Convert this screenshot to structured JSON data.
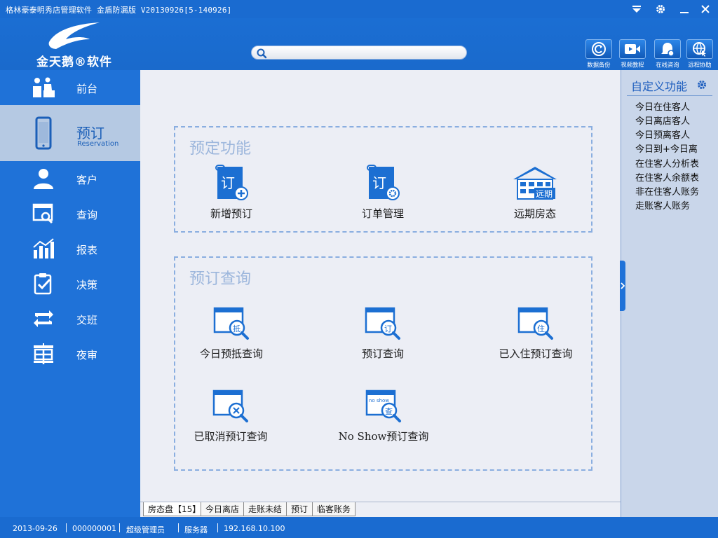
{
  "window": {
    "title": "格林豪泰明秀店管理软件 金盾防漏版 V20130926[5-140926]"
  },
  "brand": {
    "name": "金天鹅",
    "suffix": "软件"
  },
  "search": {
    "placeholder": "",
    "value": ""
  },
  "toolbar": [
    {
      "label": "数据备份",
      "icon": "backup-icon"
    },
    {
      "label": "视频教程",
      "icon": "video-icon"
    },
    {
      "label": "在线咨询",
      "icon": "chat-icon"
    },
    {
      "label": "远程协助",
      "icon": "remote-icon"
    }
  ],
  "sidebar": {
    "items": [
      {
        "label": "前台",
        "icon": "front-desk-icon"
      },
      {
        "label": "预订",
        "sub": "Reservation",
        "icon": "phone-icon",
        "active": true
      },
      {
        "label": "客户",
        "icon": "customer-icon"
      },
      {
        "label": "查询",
        "icon": "query-icon"
      },
      {
        "label": "报表",
        "icon": "report-icon"
      },
      {
        "label": "决策",
        "icon": "decision-icon"
      },
      {
        "label": "交班",
        "icon": "shift-icon"
      },
      {
        "label": "夜审",
        "icon": "night-audit-icon"
      }
    ]
  },
  "groups": [
    {
      "title": "预定功能",
      "items": [
        {
          "label": "新增预订",
          "icon_text": "订"
        },
        {
          "label": "订单管理",
          "icon_text": "订"
        },
        {
          "label": "远期房态",
          "icon_text": "远期"
        }
      ]
    },
    {
      "title": "预订查询",
      "items": [
        {
          "label": "今日预抵查询",
          "icon_text": "抵"
        },
        {
          "label": "预订查询",
          "icon_text": "订"
        },
        {
          "label": "已入住预订查询",
          "icon_text": "住"
        },
        {
          "label": "已取消预订查询",
          "icon_text": ""
        },
        {
          "label": "No Show预订查询",
          "icon_text": "查",
          "icon_small": "no show"
        }
      ]
    }
  ],
  "right_panel": {
    "title": "自定义功能",
    "items": [
      "今日在住客人",
      "今日离店客人",
      "今日预离客人",
      "今日到+今日离",
      "在住客人分析表",
      "在住客人余额表",
      "非在住客人账务",
      "走账客人账务"
    ]
  },
  "tabs": [
    {
      "label": "房态盘【15】",
      "active": true
    },
    {
      "label": "今日离店"
    },
    {
      "label": "走账未结"
    },
    {
      "label": "预订"
    },
    {
      "label": "临客账务"
    }
  ],
  "status": {
    "date": "2013-09-26",
    "user_id": "000000001",
    "role": "超级管理员",
    "server_label": "服务器",
    "server_ip": "192.168.10.100"
  },
  "colors": {
    "primary": "#1f72d8",
    "active_nav": "#b5c9e3",
    "content_bg": "#eceef5",
    "group_title": "#9cb6dc"
  }
}
